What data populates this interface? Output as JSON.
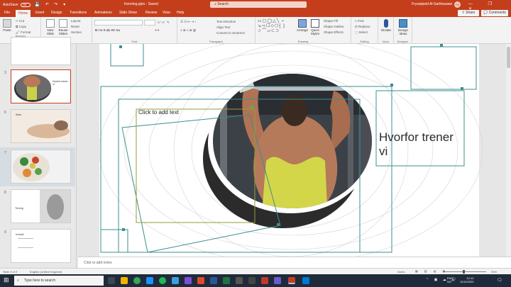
{
  "titlebar": {
    "autosave_label": "AutoSave",
    "autosave_state": "Off",
    "doc_title": "Kenning.pptx - Saved",
    "search_placeholder": "Search",
    "user_name": "Fryswipeid Al-Sarkhasawi",
    "user_initials": "FA",
    "window_controls": "— ❐ ✕"
  },
  "tabs": [
    "File",
    "Home",
    "Insert",
    "Design",
    "Transitions",
    "Animations",
    "Slide Show",
    "Review",
    "View",
    "Help"
  ],
  "active_tab": "Home",
  "share_label": "Share",
  "comments_label": "Comments",
  "ribbon": {
    "clipboard": {
      "label": "Clipboard",
      "paste": "Paste",
      "cut": "Cut",
      "copy": "Copy",
      "format_painter": "Format Painter"
    },
    "slides": {
      "label": "Slides",
      "new_slide": "New Slide",
      "reuse_slides": "Reuse Slides",
      "layout": "Layout",
      "reset": "Reset",
      "section": "Section"
    },
    "font": {
      "label": "Font"
    },
    "paragraph": {
      "label": "Paragraph",
      "text_direction": "Text Direction",
      "align_text": "Align Text",
      "convert_smartart": "Convert to SmartArt"
    },
    "drawing": {
      "label": "Drawing",
      "arrange": "Arrange",
      "quick_styles": "Quick Styles",
      "shape_fill": "Shape Fill",
      "shape_outline": "Shape Outline",
      "shape_effects": "Shape Effects"
    },
    "editing": {
      "label": "Editing",
      "find": "Find",
      "replace": "Replace",
      "select": "Select"
    },
    "voice": {
      "label": "Voice",
      "dictate": "Dictate"
    },
    "designer": {
      "label": "Designer",
      "design_ideas": "Design Ideas"
    }
  },
  "slides": [
    {
      "num": "3",
      "text": "Hvorfor trener vi"
    },
    {
      "num": "6",
      "text": "Søvn"
    },
    {
      "num": "7",
      "text": ""
    },
    {
      "num": "8",
      "text": "Trening"
    },
    {
      "num": "9",
      "text": "Innhold"
    }
  ],
  "slide": {
    "title": "Hvorfor trener vi",
    "placeholder": "Click to add text"
  },
  "notes_placeholder": "Click to add notes",
  "status": {
    "slide_count": "Slide 3 of 9",
    "language": "English (United Kingdom)",
    "notes": "Notes",
    "zoom": "93%"
  },
  "taskbar": {
    "search_placeholder": "Type here to search",
    "lang": "ENG",
    "region": "NO",
    "time": "12:12",
    "date": "11/11/2020"
  },
  "colors": {
    "accent": "#c43e1c",
    "selection": "#3b8f8f"
  }
}
